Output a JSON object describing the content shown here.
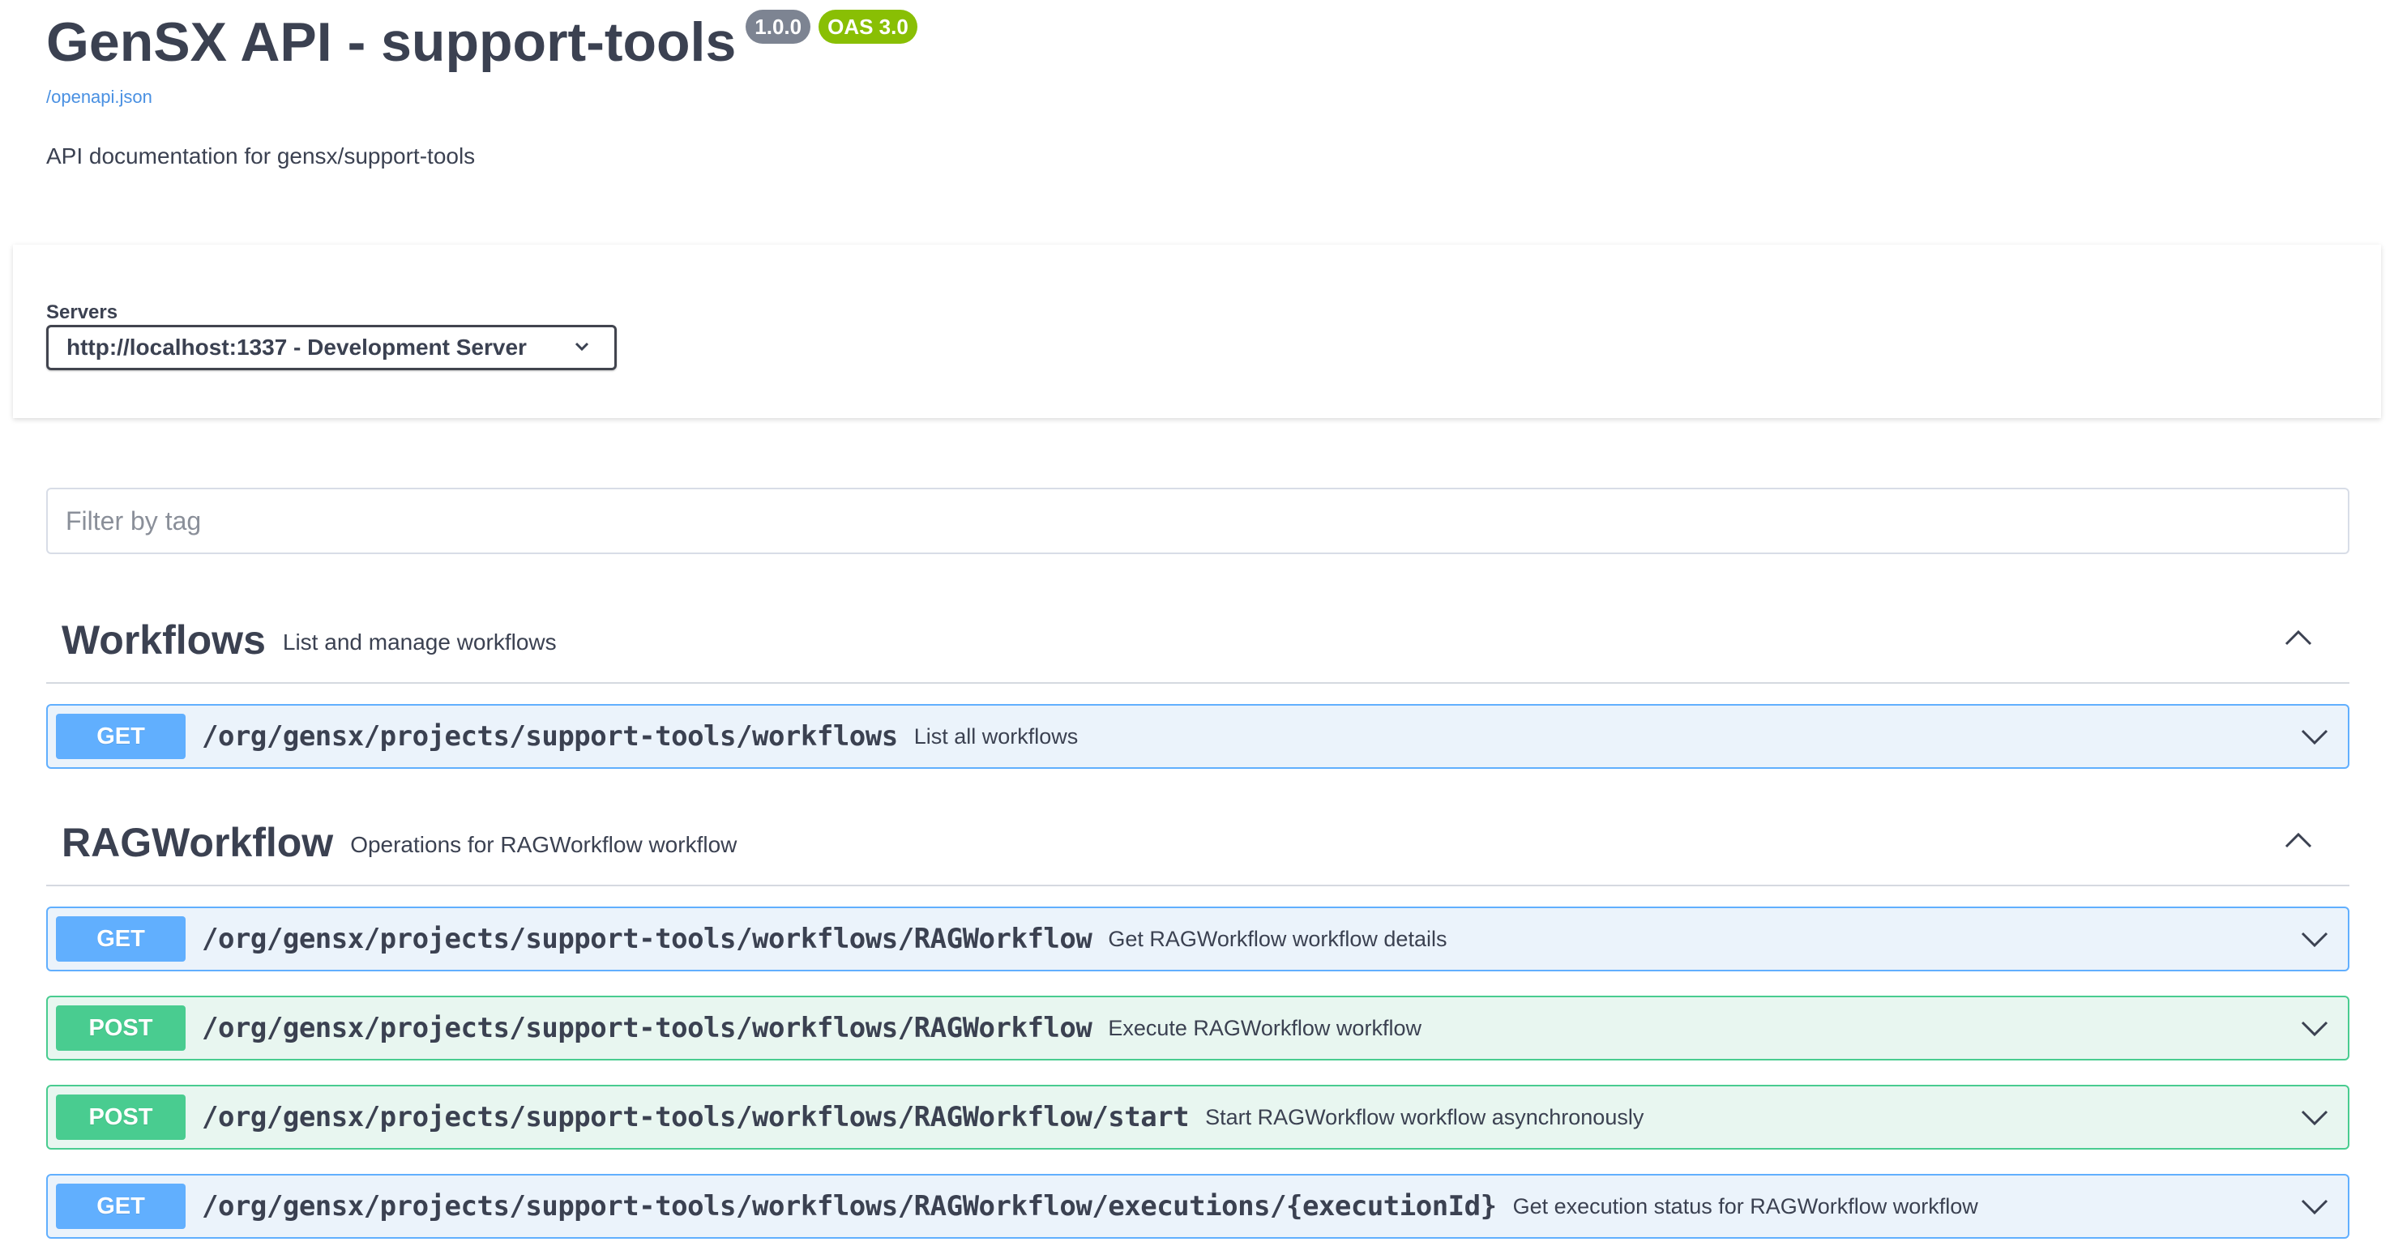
{
  "info": {
    "title": "GenSX API - support-tools",
    "version": "1.0.0",
    "oas": "OAS 3.0",
    "spec_link": "/openapi.json",
    "description": "API documentation for gensx/support-tools"
  },
  "servers": {
    "label": "Servers",
    "selected": "http://localhost:1337 - Development Server"
  },
  "filter": {
    "placeholder": "Filter by tag"
  },
  "tags": [
    {
      "name": "Workflows",
      "description": "List and manage workflows",
      "operations": [
        {
          "method": "GET",
          "path": "/org/gensx/projects/support-tools/workflows",
          "summary": "List all workflows"
        }
      ]
    },
    {
      "name": "RAGWorkflow",
      "description": "Operations for RAGWorkflow workflow",
      "operations": [
        {
          "method": "GET",
          "path": "/org/gensx/projects/support-tools/workflows/RAGWorkflow",
          "summary": "Get RAGWorkflow workflow details"
        },
        {
          "method": "POST",
          "path": "/org/gensx/projects/support-tools/workflows/RAGWorkflow",
          "summary": "Execute RAGWorkflow workflow"
        },
        {
          "method": "POST",
          "path": "/org/gensx/projects/support-tools/workflows/RAGWorkflow/start",
          "summary": "Start RAGWorkflow workflow asynchronously"
        },
        {
          "method": "GET",
          "path": "/org/gensx/projects/support-tools/workflows/RAGWorkflow/executions/{executionId}",
          "summary": "Get execution status for RAGWorkflow workflow"
        }
      ]
    }
  ],
  "colors": {
    "get": "#61affe",
    "post": "#49cc90",
    "text": "#3b4151",
    "link": "#4990e2",
    "version_badge": "#7d8492",
    "oas_badge": "#89bf04"
  },
  "icons": {
    "server_dropdown": "chevron-down-icon",
    "tag_toggle": "chevron-up-icon",
    "operation_toggle": "chevron-down-icon"
  }
}
